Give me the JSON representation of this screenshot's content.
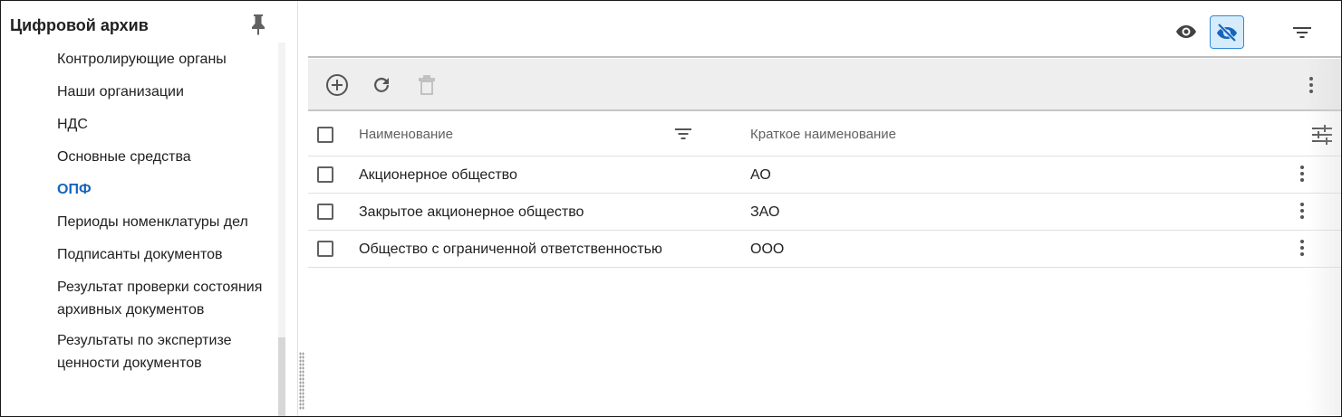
{
  "sidebar": {
    "title": "Цифровой архив",
    "pin_icon": "pin-icon",
    "items": [
      {
        "label": "Контролирующие органы",
        "active": false
      },
      {
        "label": "Наши организации",
        "active": false
      },
      {
        "label": "НДС",
        "active": false
      },
      {
        "label": "Основные средства",
        "active": false
      },
      {
        "label": "ОПФ",
        "active": true
      },
      {
        "label": "Периоды номенклатуры дел",
        "active": false
      },
      {
        "label": "Подписанты документов",
        "active": false
      },
      {
        "label": "Результат проверки состояния архивных документов",
        "active": false
      },
      {
        "label": "Результаты по экспертизе ценности документов",
        "active": false
      }
    ]
  },
  "topbar": {
    "icons": [
      "eye-icon",
      "eye-off-icon",
      "filter-icon"
    ],
    "active_toggle": "eye-off-icon"
  },
  "toolbar": {
    "icons": [
      "add-circle-icon",
      "refresh-icon",
      "delete-icon",
      "more-vertical-icon"
    ]
  },
  "table": {
    "columns": [
      "Наименование",
      "Краткое наименование"
    ],
    "rows": [
      {
        "name": "Акционерное общество",
        "short": "АО"
      },
      {
        "name": "Закрытое акционерное общество",
        "short": "ЗАО"
      },
      {
        "name": "Общество с ограниченной ответственностью",
        "short": "ООО"
      }
    ]
  },
  "colors": {
    "accent": "#1565c0",
    "toggle_bg": "#d6ecfb",
    "toggle_border": "#2f8ad8",
    "toolbar_bg": "#eeeeee"
  }
}
